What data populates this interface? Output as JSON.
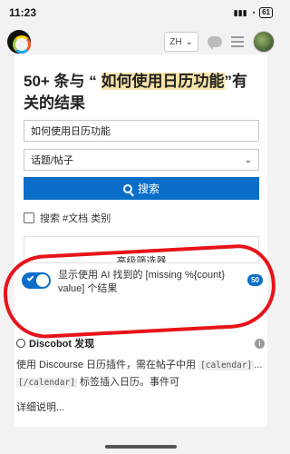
{
  "status_bar": {
    "time": "11:23",
    "signal": "ⓃⓄ",
    "battery": "61"
  },
  "header": {
    "language": "ZH"
  },
  "results": {
    "title_prefix": "50+ 条与 “ ",
    "query_highlight": "如何使用日历功能",
    "title_suffix": "”有关的结果",
    "search_value": "如何使用日历功能",
    "type_select": "话题/帖子",
    "search_button": "搜索",
    "filter_checkbox": "搜索 #文档 类别",
    "advanced_label": "高级筛选器",
    "ai_toggle_text": "显示使用 AI 找到的 [missing %{count} value] 个结果",
    "ai_count": "50"
  },
  "discobot": {
    "heading": "Discobot 发现",
    "text_before": "使用 Discourse 日历插件，需在帖子中用 ",
    "code1": "[calendar]",
    "text_mid": "...",
    "code2": "[/calendar]",
    "text_after": " 标签插入日历。事件可",
    "more": "详细说明..."
  },
  "colors": {
    "accent": "#0a6ec8",
    "annotation": "#e8131a",
    "highlight": "#f5e3a8"
  }
}
